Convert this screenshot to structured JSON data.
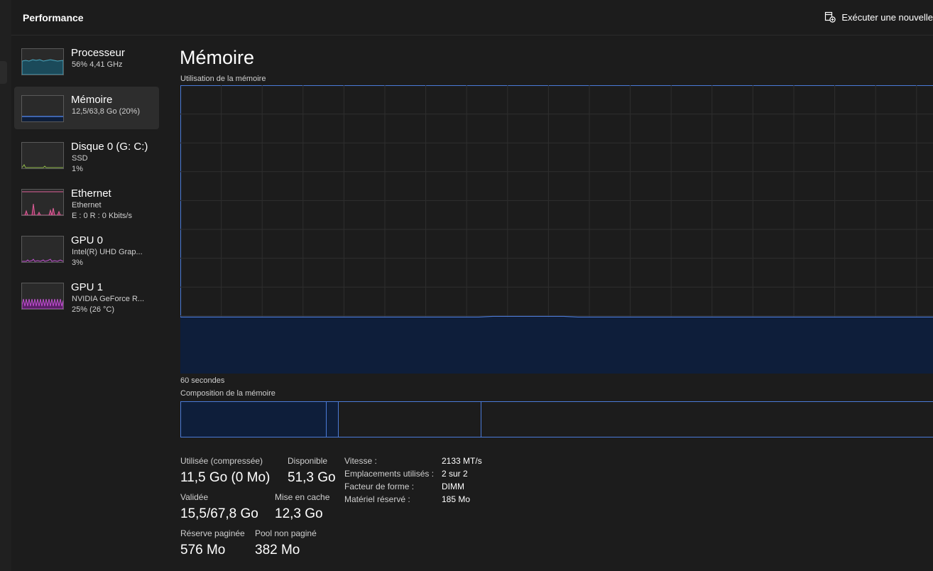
{
  "header": {
    "title": "Performance",
    "run_task_label": "Exécuter une nouvelle"
  },
  "colors": {
    "accent": "#4a7ad8",
    "memory_fill": "#0e1e3a",
    "cpu": "#4aa8c0",
    "disk": "#8fb848",
    "ethernet": "#e0609a",
    "gpu": "#c050d0"
  },
  "sidebar": {
    "items": [
      {
        "name": "Processeur",
        "line1": "56% 4,41 GHz",
        "line2": ""
      },
      {
        "name": "Mémoire",
        "line1": "12,5/63,8 Go (20%)",
        "line2": ""
      },
      {
        "name": "Disque 0 (G: C:)",
        "line1": "SSD",
        "line2": "1%"
      },
      {
        "name": "Ethernet",
        "line1": "Ethernet",
        "line2": "E : 0 R : 0 Kbits/s"
      },
      {
        "name": "GPU 0",
        "line1": "Intel(R) UHD Grap...",
        "line2": "3%"
      },
      {
        "name": "GPU 1",
        "line1": "NVIDIA GeForce R...",
        "line2": "25% (26 °C)"
      }
    ]
  },
  "main": {
    "title": "Mémoire",
    "chart_label": "Utilisation de la mémoire",
    "time_label": "60 secondes",
    "composition_label": "Composition de la mémoire",
    "usage_fraction": 0.196
  },
  "stats": {
    "used_label": "Utilisée (compressée)",
    "used_value": "11,5 Go (0 Mo)",
    "available_label": "Disponible",
    "available_value": "51,3 Go",
    "committed_label": "Validée",
    "committed_value": "15,5/67,8 Go",
    "cached_label": "Mise en cache",
    "cached_value": "12,3 Go",
    "paged_label": "Réserve paginée",
    "paged_value": "576 Mo",
    "nonpaged_label": "Pool non paginé",
    "nonpaged_value": "382 Mo"
  },
  "details": {
    "speed_key": "Vitesse :",
    "speed_val": "2133 MT/s",
    "slots_key": "Emplacements utilisés :",
    "slots_val": "2 sur 2",
    "form_key": "Facteur de forme :",
    "form_val": "DIMM",
    "reserved_key": "Matériel réservé :",
    "reserved_val": "185 Mo"
  }
}
